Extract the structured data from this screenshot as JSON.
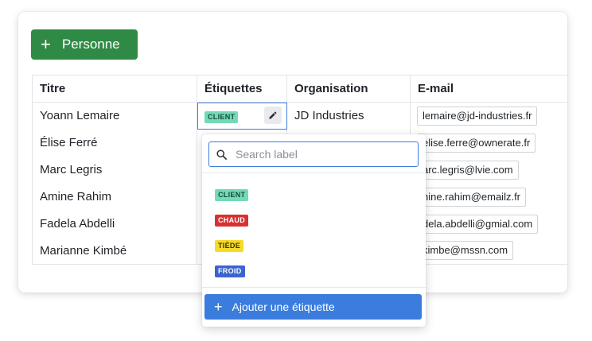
{
  "toolbar": {
    "add_person_label": "Personne"
  },
  "table": {
    "headers": [
      "Titre",
      "Étiquettes",
      "Organisation",
      "E-mail"
    ],
    "rows": [
      {
        "title": "Yoann Lemaire",
        "tag": "CLIENT",
        "organisation": "JD Industries",
        "email": "lemaire@jd-industries.fr"
      },
      {
        "title": "Élise Ferré",
        "email": "elise.ferre@ownerate.fr"
      },
      {
        "title": "Marc Legris",
        "email": "arc.legris@lvie.com"
      },
      {
        "title": "Amine Rahim",
        "email": "nine.rahim@emailz.fr"
      },
      {
        "title": "Fadela Abdelli",
        "email": "dela.abdelli@gmial.com"
      },
      {
        "title": "Marianne Kimbé",
        "email": "kimbe@mssn.com"
      }
    ]
  },
  "label_popover": {
    "search_placeholder": "Search label",
    "options": [
      "CLIENT",
      "CHAUD",
      "TIÈDE",
      "FROID"
    ],
    "add_button_label": "Ajouter une étiquette"
  },
  "colors": {
    "primary_green": "#2f8a45",
    "accent_blue": "#3b7ddd",
    "client": "#74d9b7",
    "chaud": "#d63232",
    "tiede": "#f5da2a",
    "froid": "#3b64d0"
  },
  "icons": [
    "plus-icon",
    "pencil-icon",
    "search-icon"
  ]
}
